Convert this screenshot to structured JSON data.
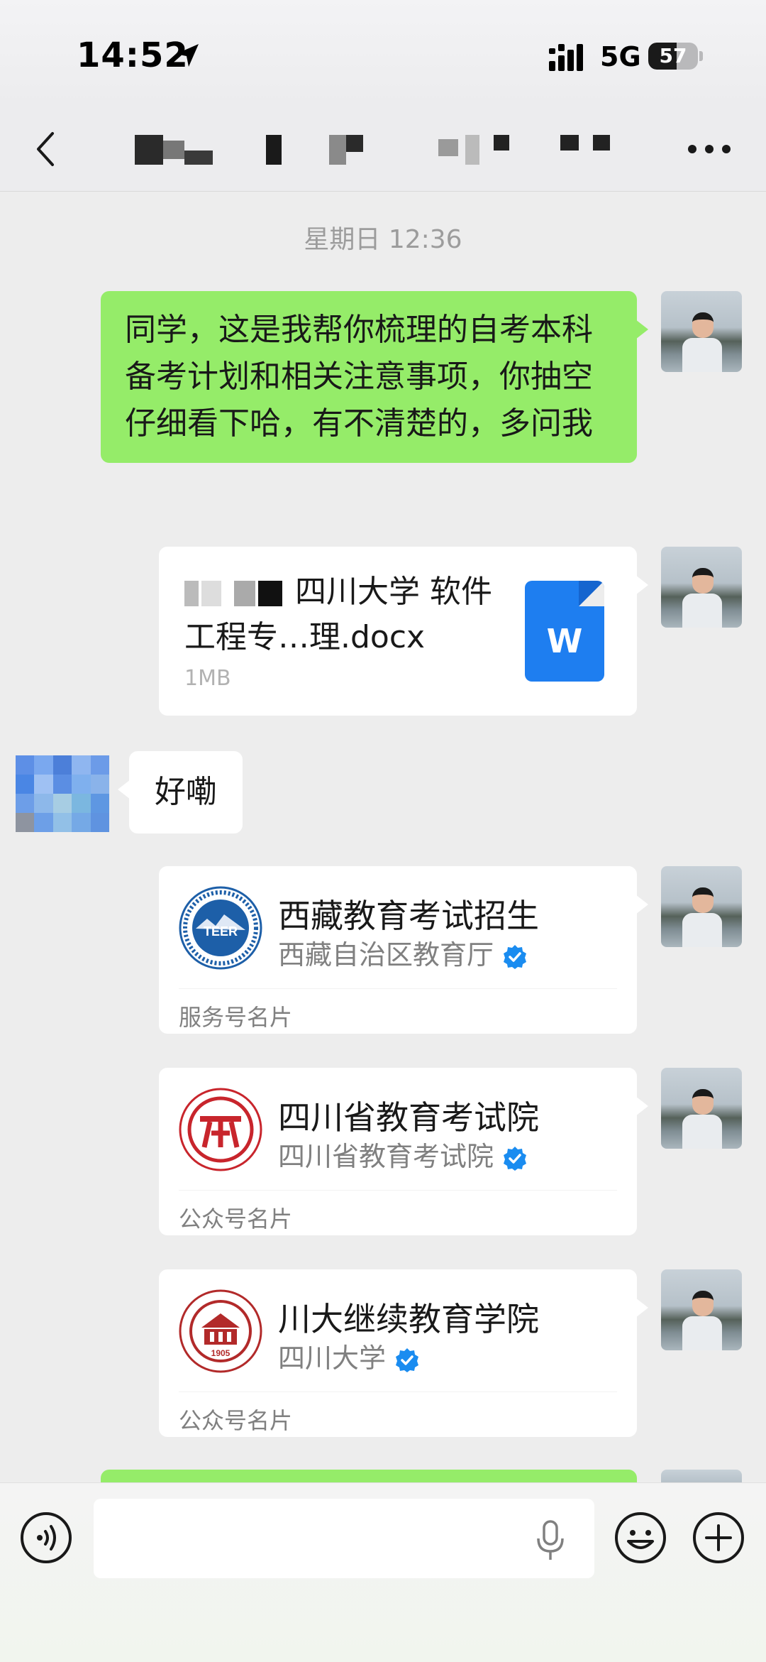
{
  "status_bar": {
    "time": "14:52",
    "network": "5G",
    "battery_level": "57",
    "battery_fraction": 0.57
  },
  "nav": {
    "title": "",
    "more_icon": "more-icon",
    "back_icon": "back-icon"
  },
  "chat": {
    "timestamp": "星期日 12:36",
    "message_1": "同学，这是我帮你梳理的自考本科备考计划和相关注意事项，你抽空仔细看下哈，有不清楚的，多问我",
    "file": {
      "name": "四川大学 软件工程专…理.docx",
      "size": "1MB",
      "icon_letter": "W",
      "icon_color": "#1e7ef0"
    },
    "reply": "好嘞",
    "cards": [
      {
        "name": "西藏教育考试招生",
        "owner": "西藏自治区教育厅",
        "type": "服务号名片",
        "logo_text": "TEER",
        "logo_color": "#1d5fa8"
      },
      {
        "name": "四川省教育考试院",
        "owner": "四川省教育考试院",
        "type": "公众号名片",
        "logo_color": "#c8252c"
      },
      {
        "name": "川大继续教育学院",
        "owner": "四川大学",
        "type": "公众号名片",
        "logo_text": "1905",
        "logo_color": "#b22a2a"
      }
    ]
  },
  "colors": {
    "bubble_green": "#95ec69",
    "verified_blue": "#1a8cf0",
    "background": "#ededed"
  },
  "input_bar": {
    "placeholder": "",
    "icons": [
      "voice-icon",
      "mic-icon",
      "emoji-icon",
      "plus-icon"
    ]
  }
}
